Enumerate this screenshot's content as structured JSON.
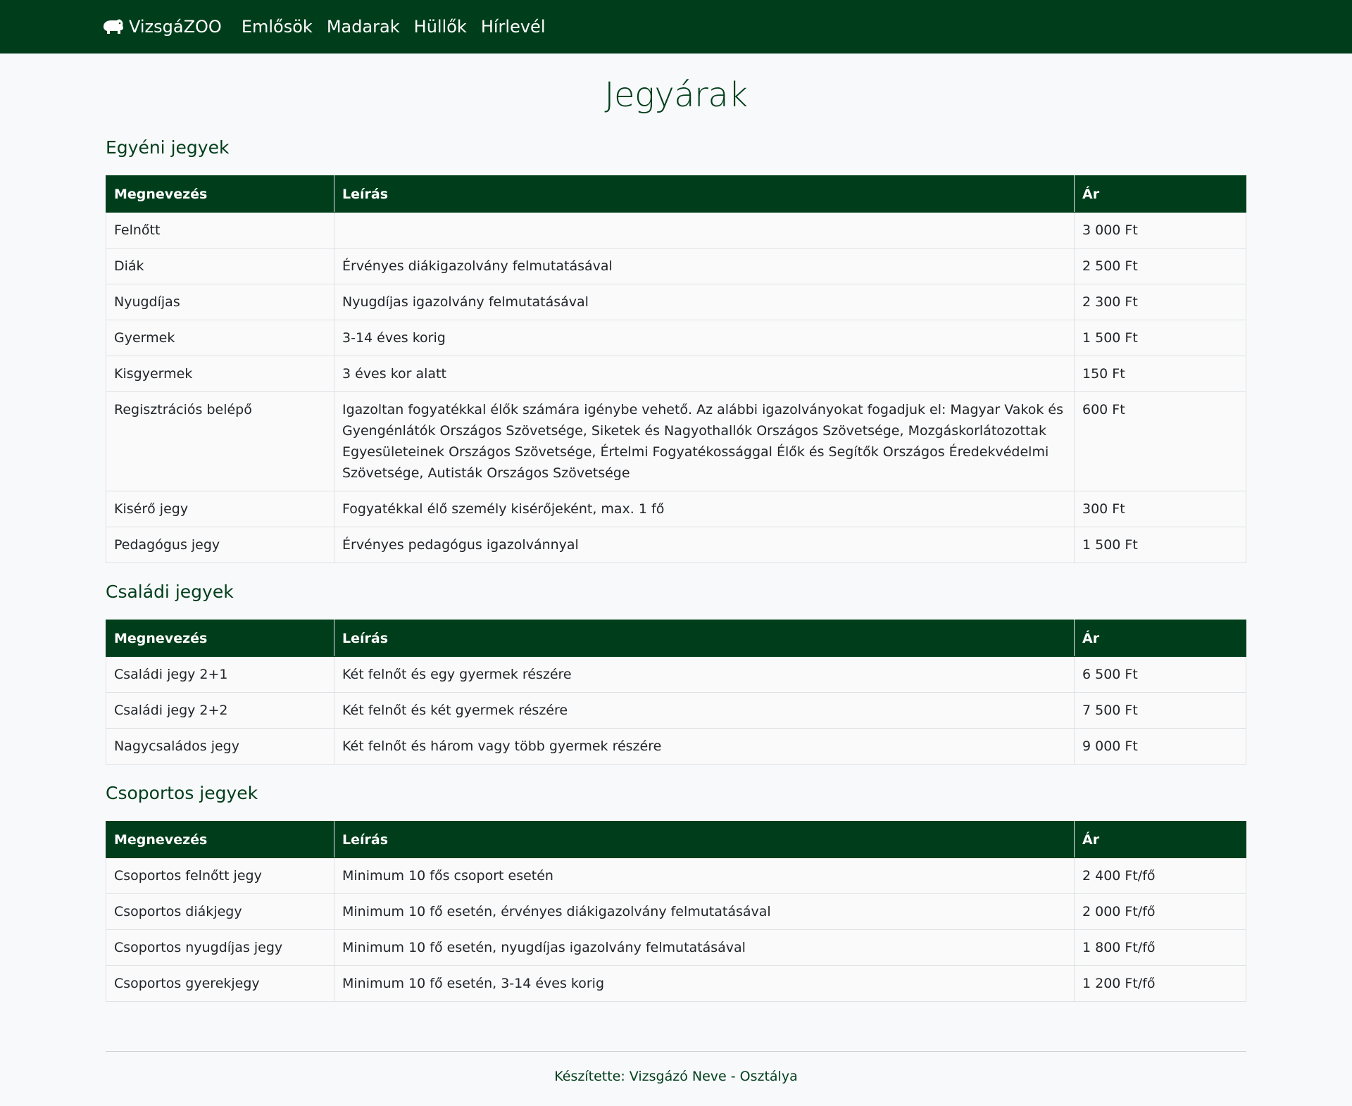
{
  "navbar": {
    "brand": "VizsgáZOO",
    "links": [
      "Emlősök",
      "Madarak",
      "Hüllők",
      "Hírlevél"
    ]
  },
  "page_title": "Jegyárak",
  "table_headers": {
    "name": "Megnevezés",
    "description": "Leírás",
    "price": "Ár"
  },
  "sections": [
    {
      "title": "Egyéni jegyek",
      "rows": [
        {
          "name": "Felnőtt",
          "description": "",
          "price": "3 000 Ft"
        },
        {
          "name": "Diák",
          "description": "Érvényes diákigazolvány felmutatásával",
          "price": "2 500 Ft"
        },
        {
          "name": "Nyugdíjas",
          "description": "Nyugdíjas igazolvány felmutatásával",
          "price": "2 300 Ft"
        },
        {
          "name": "Gyermek",
          "description": "3-14 éves korig",
          "price": "1 500 Ft"
        },
        {
          "name": "Kisgyermek",
          "description": "3 éves kor alatt",
          "price": "150 Ft"
        },
        {
          "name": "Regisztrációs belépő",
          "description": "Igazoltan fogyatékkal élők számára igénybe vehető. Az alábbi igazolványokat fogadjuk el: Magyar Vakok és Gyengénlátók Országos Szövetsége, Siketek és Nagyothallók Országos Szövetsége, Mozgáskorlátozottak Egyesületeinek Országos Szövetsége, Értelmi Fogyatékossággal Élők és Segítők Országos Éredekvédelmi Szövetsége, Autisták Országos Szövetsége",
          "price": "600 Ft"
        },
        {
          "name": "Kisérő jegy",
          "description": "Fogyatékkal élő személy kisérőjeként, max. 1 fő",
          "price": "300 Ft"
        },
        {
          "name": "Pedagógus jegy",
          "description": "Érvényes pedagógus igazolvánnyal",
          "price": "1 500 Ft"
        }
      ]
    },
    {
      "title": "Családi jegyek",
      "rows": [
        {
          "name": "Családi jegy 2+1",
          "description": "Két felnőt és egy gyermek részére",
          "price": "6 500 Ft"
        },
        {
          "name": "Családi jegy 2+2",
          "description": "Két felnőt és két gyermek részére",
          "price": "7 500 Ft"
        },
        {
          "name": "Nagycsaládos jegy",
          "description": "Két felnőt és három vagy több gyermek részére",
          "price": "9 000 Ft"
        }
      ]
    },
    {
      "title": "Csoportos jegyek",
      "rows": [
        {
          "name": "Csoportos felnőtt jegy",
          "description": "Minimum 10 fős csoport esetén",
          "price": "2 400 Ft/fő"
        },
        {
          "name": "Csoportos diákjegy",
          "description": "Minimum 10 fő esetén, érvényes diákigazolvány felmutatásával",
          "price": "2 000 Ft/fő"
        },
        {
          "name": "Csoportos nyugdíjas jegy",
          "description": "Minimum 10 fő esetén, nyugdíjas igazolvány felmutatásával",
          "price": "1 800 Ft/fő"
        },
        {
          "name": "Csoportos gyerekjegy",
          "description": "Minimum 10 fő esetén, 3-14 éves korig",
          "price": "1 200 Ft/fő"
        }
      ]
    }
  ],
  "footer": {
    "text": "Készítette: Vizsgázó Neve - Osztálya"
  },
  "colors": {
    "primary": "#003e1b",
    "background": "#f8f9fa",
    "border": "#dee2e6"
  },
  "icons": {
    "brand": "hippo-icon"
  }
}
